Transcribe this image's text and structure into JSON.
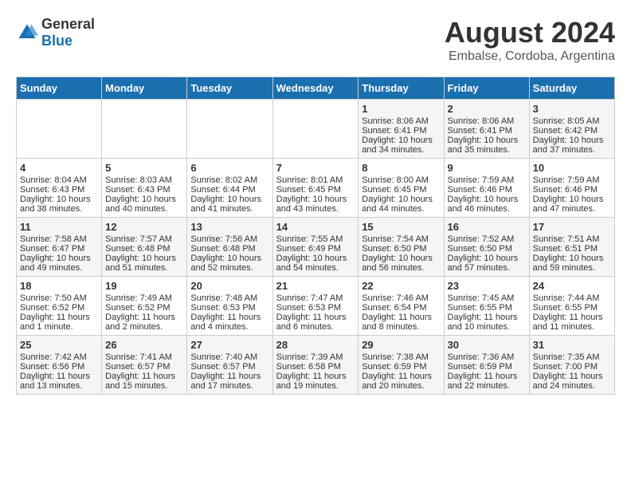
{
  "header": {
    "logo": {
      "general": "General",
      "blue": "Blue"
    },
    "title": "August 2024",
    "location": "Embalse, Cordoba, Argentina"
  },
  "days_of_week": [
    "Sunday",
    "Monday",
    "Tuesday",
    "Wednesday",
    "Thursday",
    "Friday",
    "Saturday"
  ],
  "weeks": [
    [
      {
        "day": "",
        "info": ""
      },
      {
        "day": "",
        "info": ""
      },
      {
        "day": "",
        "info": ""
      },
      {
        "day": "",
        "info": ""
      },
      {
        "day": "1",
        "sunrise": "8:06 AM",
        "sunset": "6:41 PM",
        "daylight": "10 hours and 34 minutes."
      },
      {
        "day": "2",
        "sunrise": "8:06 AM",
        "sunset": "6:41 PM",
        "daylight": "10 hours and 35 minutes."
      },
      {
        "day": "3",
        "sunrise": "8:05 AM",
        "sunset": "6:42 PM",
        "daylight": "10 hours and 37 minutes."
      }
    ],
    [
      {
        "day": "4",
        "sunrise": "8:04 AM",
        "sunset": "6:43 PM",
        "daylight": "10 hours and 38 minutes."
      },
      {
        "day": "5",
        "sunrise": "8:03 AM",
        "sunset": "6:43 PM",
        "daylight": "10 hours and 40 minutes."
      },
      {
        "day": "6",
        "sunrise": "8:02 AM",
        "sunset": "6:44 PM",
        "daylight": "10 hours and 41 minutes."
      },
      {
        "day": "7",
        "sunrise": "8:01 AM",
        "sunset": "6:45 PM",
        "daylight": "10 hours and 43 minutes."
      },
      {
        "day": "8",
        "sunrise": "8:00 AM",
        "sunset": "6:45 PM",
        "daylight": "10 hours and 44 minutes."
      },
      {
        "day": "9",
        "sunrise": "7:59 AM",
        "sunset": "6:46 PM",
        "daylight": "10 hours and 46 minutes."
      },
      {
        "day": "10",
        "sunrise": "7:59 AM",
        "sunset": "6:46 PM",
        "daylight": "10 hours and 47 minutes."
      }
    ],
    [
      {
        "day": "11",
        "sunrise": "7:58 AM",
        "sunset": "6:47 PM",
        "daylight": "10 hours and 49 minutes."
      },
      {
        "day": "12",
        "sunrise": "7:57 AM",
        "sunset": "6:48 PM",
        "daylight": "10 hours and 51 minutes."
      },
      {
        "day": "13",
        "sunrise": "7:56 AM",
        "sunset": "6:48 PM",
        "daylight": "10 hours and 52 minutes."
      },
      {
        "day": "14",
        "sunrise": "7:55 AM",
        "sunset": "6:49 PM",
        "daylight": "10 hours and 54 minutes."
      },
      {
        "day": "15",
        "sunrise": "7:54 AM",
        "sunset": "6:50 PM",
        "daylight": "10 hours and 56 minutes."
      },
      {
        "day": "16",
        "sunrise": "7:52 AM",
        "sunset": "6:50 PM",
        "daylight": "10 hours and 57 minutes."
      },
      {
        "day": "17",
        "sunrise": "7:51 AM",
        "sunset": "6:51 PM",
        "daylight": "10 hours and 59 minutes."
      }
    ],
    [
      {
        "day": "18",
        "sunrise": "7:50 AM",
        "sunset": "6:52 PM",
        "daylight": "11 hours and 1 minute."
      },
      {
        "day": "19",
        "sunrise": "7:49 AM",
        "sunset": "6:52 PM",
        "daylight": "11 hours and 2 minutes."
      },
      {
        "day": "20",
        "sunrise": "7:48 AM",
        "sunset": "6:53 PM",
        "daylight": "11 hours and 4 minutes."
      },
      {
        "day": "21",
        "sunrise": "7:47 AM",
        "sunset": "6:53 PM",
        "daylight": "11 hours and 6 minutes."
      },
      {
        "day": "22",
        "sunrise": "7:46 AM",
        "sunset": "6:54 PM",
        "daylight": "11 hours and 8 minutes."
      },
      {
        "day": "23",
        "sunrise": "7:45 AM",
        "sunset": "6:55 PM",
        "daylight": "11 hours and 10 minutes."
      },
      {
        "day": "24",
        "sunrise": "7:44 AM",
        "sunset": "6:55 PM",
        "daylight": "11 hours and 11 minutes."
      }
    ],
    [
      {
        "day": "25",
        "sunrise": "7:42 AM",
        "sunset": "6:56 PM",
        "daylight": "11 hours and 13 minutes."
      },
      {
        "day": "26",
        "sunrise": "7:41 AM",
        "sunset": "6:57 PM",
        "daylight": "11 hours and 15 minutes."
      },
      {
        "day": "27",
        "sunrise": "7:40 AM",
        "sunset": "6:57 PM",
        "daylight": "11 hours and 17 minutes."
      },
      {
        "day": "28",
        "sunrise": "7:39 AM",
        "sunset": "6:58 PM",
        "daylight": "11 hours and 19 minutes."
      },
      {
        "day": "29",
        "sunrise": "7:38 AM",
        "sunset": "6:59 PM",
        "daylight": "11 hours and 20 minutes."
      },
      {
        "day": "30",
        "sunrise": "7:36 AM",
        "sunset": "6:59 PM",
        "daylight": "11 hours and 22 minutes."
      },
      {
        "day": "31",
        "sunrise": "7:35 AM",
        "sunset": "7:00 PM",
        "daylight": "11 hours and 24 minutes."
      }
    ]
  ],
  "labels": {
    "sunrise": "Sunrise:",
    "sunset": "Sunset:",
    "daylight": "Daylight:"
  }
}
